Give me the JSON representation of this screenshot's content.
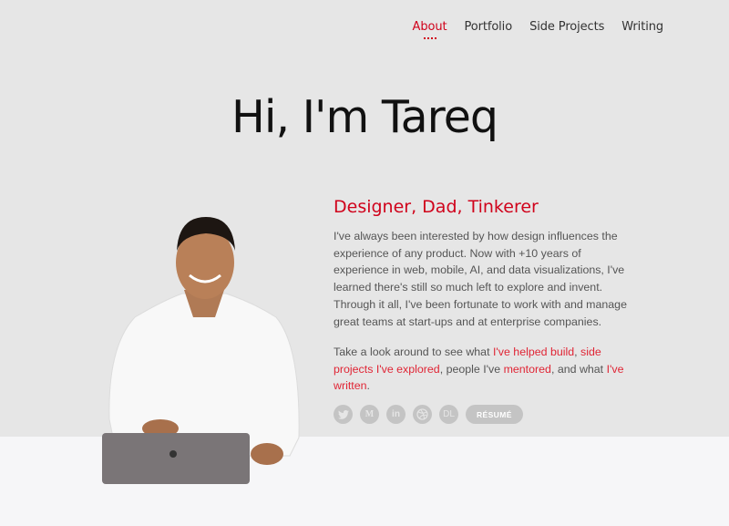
{
  "nav": {
    "items": [
      {
        "label": "About",
        "active": true
      },
      {
        "label": "Portfolio",
        "active": false
      },
      {
        "label": "Side Projects",
        "active": false
      },
      {
        "label": "Writing",
        "active": false
      }
    ]
  },
  "hero": {
    "title": "Hi, I'm Tareq",
    "subtitle": "Designer, Dad, Tinkerer",
    "bio": "I've always been interested by how design influences the experience of any product. Now with +10 years of experience in web, mobile, AI, and data visualizations, I've learned there's still so much left to explore and invent. Through it all, I've been fortunate to work with and manage great teams at start-ups and at enterprise companies.",
    "cta": {
      "t1": "Take a look around to see what ",
      "l1": "I've helped build",
      "t2": ", ",
      "l2": "side projects I've explored",
      "t3": ", people I've ",
      "l3": "mentored",
      "t4": ", and what ",
      "l4": "I've written",
      "t5": "."
    },
    "photo_alt": "Portrait of Tareq smiling with a laptop"
  },
  "social": {
    "twitter": "twitter-icon",
    "medium": "M",
    "linkedin": "in",
    "dribbble": "dribbble-icon",
    "dl": "DL",
    "resume": "RÉSUMÉ"
  },
  "colors": {
    "accent": "#d0021b",
    "hero_bg": "#e6e6e6",
    "page_bg": "#f6f6f8"
  }
}
